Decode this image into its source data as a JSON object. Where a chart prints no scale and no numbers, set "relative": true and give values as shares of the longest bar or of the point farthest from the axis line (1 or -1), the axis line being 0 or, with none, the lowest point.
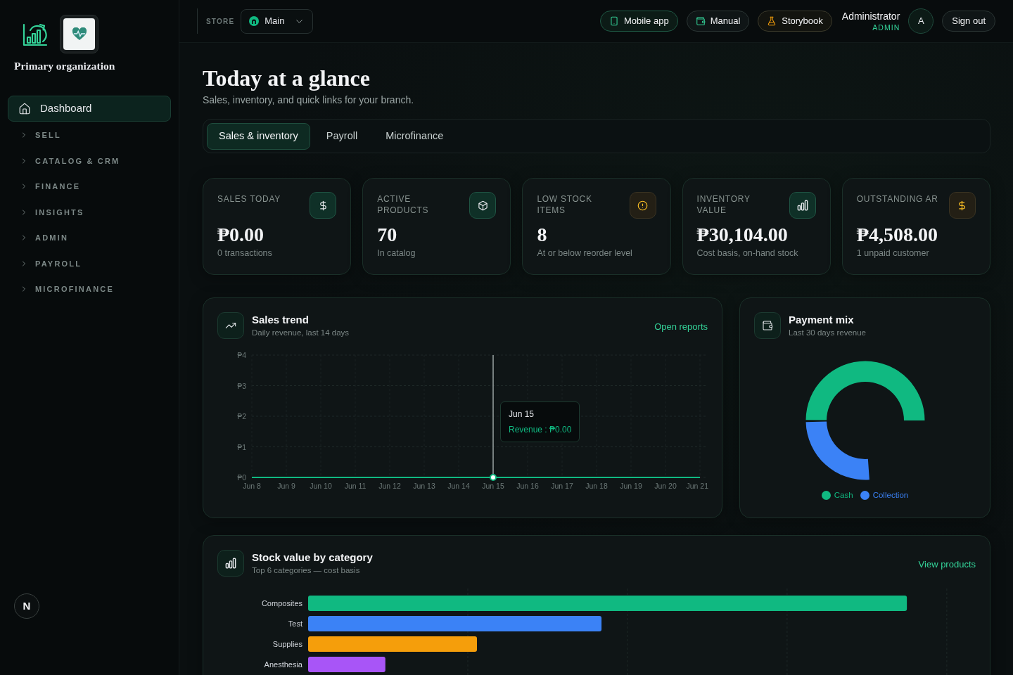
{
  "sidebar": {
    "org_name": "Primary organization",
    "nav_link": {
      "label": "Dashboard",
      "selected": true
    },
    "groups": [
      {
        "label": "SELL",
        "expanded": false
      },
      {
        "label": "CATALOG & CRM",
        "expanded": false
      },
      {
        "label": "FINANCE",
        "expanded": false
      },
      {
        "label": "INSIGHTS",
        "expanded": false
      },
      {
        "label": "ADMIN",
        "expanded": false
      },
      {
        "label": "PAYROLL",
        "expanded": false
      },
      {
        "label": "MICROFINANCE",
        "expanded": false
      }
    ],
    "dev_badge": {
      "label": "N"
    }
  },
  "topbar": {
    "store_label": "STORE",
    "store_select": {
      "value": "Main"
    },
    "links": [
      {
        "label": "Mobile app",
        "kind": "accent"
      },
      {
        "label": "Manual",
        "kind": "plain"
      },
      {
        "label": "Storybook",
        "kind": "warning"
      }
    ],
    "user": {
      "name": "Administrator",
      "role": "ADMIN",
      "avatar_initial": "A"
    },
    "sign_out": "Sign out"
  },
  "page": {
    "title": "Today at a glance",
    "subtitle": "Sales, inventory, and quick links for your branch."
  },
  "tabs": [
    {
      "label": "Sales & inventory",
      "selected": true
    },
    {
      "label": "Payroll",
      "selected": false
    },
    {
      "label": "Microfinance",
      "selected": false
    }
  ],
  "stats": [
    {
      "label": "SALES TODAY",
      "value": "₱0.00",
      "caption": "0 transactions",
      "kind": "normal"
    },
    {
      "label": "ACTIVE PRODUCTS",
      "value": "70",
      "caption": "In catalog",
      "kind": "normal"
    },
    {
      "label": "LOW STOCK ITEMS",
      "value": "8",
      "caption": "At or below reorder level",
      "kind": "warning"
    },
    {
      "label": "INVENTORY VALUE",
      "value": "₱30,104.00",
      "caption": "Cost basis, on-hand stock",
      "kind": "normal"
    },
    {
      "label": "OUTSTANDING AR",
      "value": "₱4,508.00",
      "caption": "1 unpaid customer",
      "kind": "warning"
    }
  ],
  "sales_trend": {
    "title": "Sales trend",
    "subtitle": "Daily revenue, last 14 days",
    "link": "Open reports",
    "chart_data": {
      "type": "line",
      "categories": [
        "Jun 8",
        "Jun 9",
        "Jun 10",
        "Jun 11",
        "Jun 12",
        "Jun 13",
        "Jun 14",
        "Jun 15",
        "Jun 16",
        "Jun 17",
        "Jun 18",
        "Jun 19",
        "Jun 20",
        "Jun 21"
      ],
      "series": [
        {
          "color": "#10b981",
          "values": [
            0,
            0,
            0,
            0,
            0,
            0,
            0,
            0,
            0,
            0,
            0,
            0,
            0,
            0
          ]
        }
      ],
      "ylim": [
        0,
        4
      ],
      "yticks": [
        {
          "value": 0,
          "label": "₱0"
        },
        {
          "value": 1,
          "label": "₱1"
        },
        {
          "value": 2,
          "label": "₱2"
        },
        {
          "value": 3,
          "label": "₱3"
        },
        {
          "value": 4,
          "label": "₱4"
        }
      ],
      "grid": true,
      "annotations": [
        "Jun 15",
        "Revenue : ₱0.00"
      ],
      "ref_lines": [
        {
          "axis": "x",
          "value": "Jun 15"
        }
      ]
    }
  },
  "payment_mix": {
    "title": "Payment mix",
    "subtitle": "Last 30 days revenue",
    "chart_data": {
      "type": "donut",
      "categories": [
        "Cash",
        "Collection"
      ],
      "values": [
        66,
        34
      ],
      "colors": [
        "#10b981",
        "#3b82f6"
      ],
      "legend": "bottom"
    }
  },
  "stock_value": {
    "title": "Stock value by category",
    "subtitle": "Top 6 categories — cost basis",
    "link": "View products",
    "chart_data": {
      "type": "bar",
      "orientation": "horizontal",
      "relative": true,
      "categories": [
        "Composites",
        "Test",
        "Supplies",
        "Anesthesia"
      ],
      "values": [
        1,
        0.49,
        0.282,
        0.129
      ],
      "colors": [
        "#10b981",
        "#3b82f6",
        "#f59e0b",
        "#a855f7"
      ],
      "grid": true
    }
  }
}
